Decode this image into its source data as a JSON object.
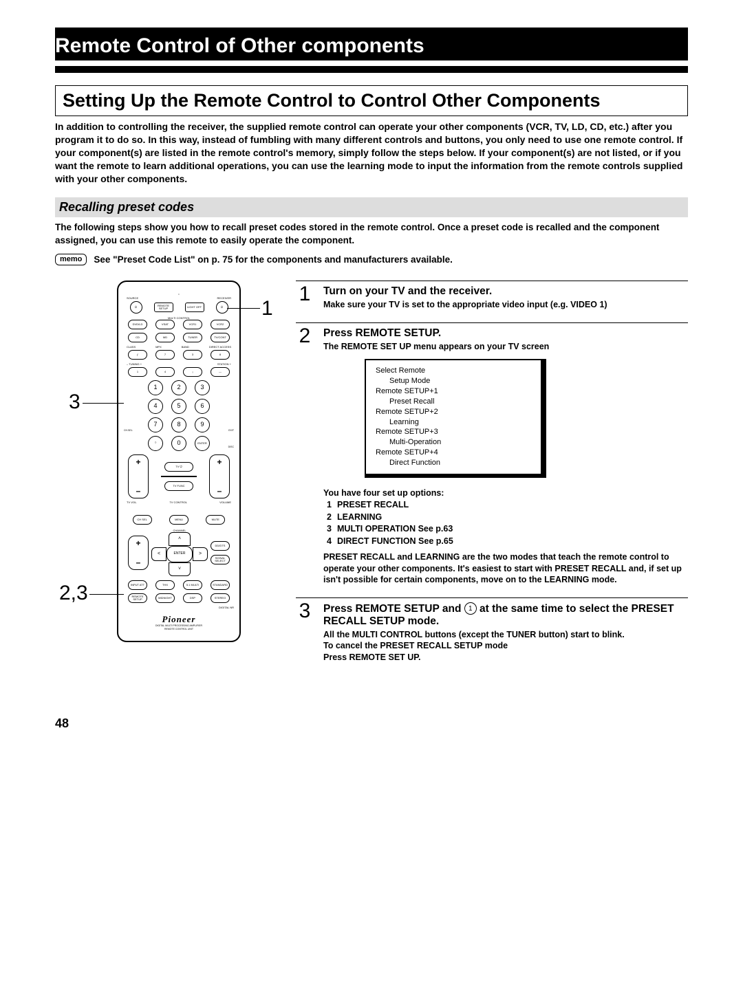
{
  "header": "Remote Control of Other components",
  "section_title": "Setting Up the Remote Control to Control Other Components",
  "intro": "In addition to controlling the receiver, the supplied remote control can operate your other components (VCR, TV, LD, CD, etc.) after you program it to do so. In this way, instead of fumbling with many different controls and buttons, you only need to use one remote control. If your component(s) are listed in the remote control's memory, simply follow the steps below. If your component(s) are not listed, or if you want the remote to learn additional operations, you can use the learning mode to input the information from the remote controls supplied with your other components.",
  "subhead": "Recalling preset codes",
  "subtext": "The following steps show you how to recall preset codes stored in the remote control. Once a preset code is recalled and the component assigned, you can use this remote to easily operate the component.",
  "memo_label": "memo",
  "memo_text": "See \"Preset Code List\" on p. 75 for the components and manufacturers available.",
  "callouts": {
    "top": "1",
    "mid": "3",
    "bottom": "2,3"
  },
  "remote": {
    "top_labels": {
      "left": "SOURCE",
      "right": "RECEIVER"
    },
    "top_center_btns": [
      "REMOTE SETUP",
      "LIGHT OFF"
    ],
    "power_icon": "⏻",
    "multi_control_label": "MULTI CONTROL",
    "mc_row1": [
      "DVD/LD",
      "VSAT",
      "VCR1",
      "VCR2"
    ],
    "mc_row2": [
      "CD",
      "MD",
      "TUNER",
      "TV/CONT"
    ],
    "func_labels": [
      "CLASS",
      "MPX",
      "BAND",
      "DIRECT ACCESS"
    ],
    "func_symbols": [
      "ƒ",
      "7",
      "3",
      "8"
    ],
    "tuning_labels": {
      "left": "– TUNING +",
      "right": "STATION +"
    },
    "tuning_btns": [
      "1",
      "4",
      "¡",
      "—"
    ],
    "numbers": [
      "1",
      "2",
      "3",
      "4",
      "5",
      "6",
      "7",
      "8",
      "9",
      "○",
      "0",
      "ENTER"
    ],
    "num_side": {
      "left": "CH.SEL",
      "right_top": "EXIT",
      "right_bottom": "DISC"
    },
    "tv_btn": "TV ⏻",
    "rocker_below": {
      "left": "TV VOL.",
      "mid": "TV CONTROL",
      "right": "VOLUME"
    },
    "tv_func": "TV FUNC",
    "lower_row1": [
      "CH SEL",
      "MENU",
      "MUTE"
    ],
    "lower_channel": "CHANNEL",
    "dpad": {
      "up": "˄",
      "down": "˅",
      "left": "˂",
      "right": "˃",
      "center": "ENTER"
    },
    "lower_side": {
      "left": "+/–",
      "right_top": "DD/DTS",
      "right_bottom": "SIGNAL SELECT"
    },
    "lower_row2": [
      "INPUT ATT",
      "THX",
      "5.1 MULTI",
      "STANDARD"
    ],
    "lower_row3": [
      "REMOTE SETUP",
      "MIDNIGHT",
      "DSP",
      "STEREO"
    ],
    "lower_label_right": "DIGITAL NR",
    "brand": "Pioneer",
    "brand_sub1": "DIGITAL MULTI PROCESSING AMPLIFIER",
    "brand_sub2": "REMOTE CONTROL UNIT"
  },
  "steps": [
    {
      "num": "1",
      "title": "Turn on your TV and the receiver.",
      "note": "Make sure your TV is set to the appropriate video input (e.g. VIDEO 1)"
    },
    {
      "num": "2",
      "title": "Press REMOTE SETUP.",
      "note": "The REMOTE SET UP menu appears on your TV screen",
      "tv": {
        "title": "Select Remote",
        "subtitle": "Setup Mode",
        "lines": [
          [
            "Remote SETUP+1",
            "Preset Recall"
          ],
          [
            "Remote SETUP+2",
            "Learning"
          ],
          [
            "Remote SETUP+3",
            "Multi-Operation"
          ],
          [
            "Remote SETUP+4",
            "Direct Function"
          ]
        ]
      },
      "options_intro": "You have four set up options:",
      "options": [
        {
          "n": "1",
          "label": "PRESET RECALL"
        },
        {
          "n": "2",
          "label": "LEARNING"
        },
        {
          "n": "3",
          "label": "MULTI OPERATION See p.63"
        },
        {
          "n": "4",
          "label": "DIRECT FUNCTION See p.65"
        }
      ],
      "options_note": "PRESET RECALL and LEARNING are the two modes that teach the remote control to operate your other components. It's easiest to start with PRESET RECALL and, if set up isn't possible for certain components, move on to the LEARNING mode."
    },
    {
      "num": "3",
      "title_pre": "Press REMOTE SETUP and ",
      "title_circle": "1",
      "title_post": " at the same time to select the PRESET RECALL SETUP mode.",
      "notes": [
        "All the MULTI CONTROL  buttons (except the TUNER button) start to blink.",
        "To cancel the PRESET RECALL SETUP mode",
        "Press REMOTE SET UP."
      ]
    }
  ],
  "page_number": "48"
}
